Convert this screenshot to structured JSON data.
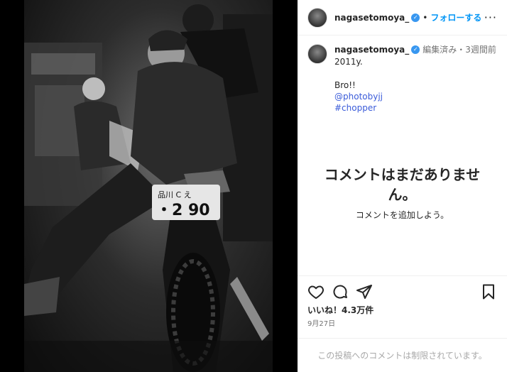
{
  "post": {
    "username": "nagasetomoya_",
    "follow_label": "フォローする",
    "dot": "•",
    "more": "···"
  },
  "caption": {
    "username": "nagasetomoya_",
    "edited": "編集済み",
    "separator": "・",
    "time": "3週間前",
    "line1": "2011y.",
    "line2": "Bro!!",
    "tag_user": "@photobyjj",
    "hashtag": "#chopper"
  },
  "comments": {
    "empty_title": "コメントはまだありません。",
    "empty_sub": "コメントを追加しよう。"
  },
  "footer": {
    "likes": "いいね！4.3万件",
    "date": "9月27日",
    "restricted": "この投稿へのコメントは制限されています。"
  },
  "photo": {
    "plate_line1": "品川 C え",
    "plate_line2": "・2 90"
  },
  "icons": [
    "heart-icon",
    "comment-icon",
    "share-icon",
    "bookmark-icon",
    "verified-icon"
  ],
  "colors": {
    "accent": "#0095f6",
    "verified": "#3897f0",
    "link": "#3a5bd9",
    "muted": "#737373"
  }
}
